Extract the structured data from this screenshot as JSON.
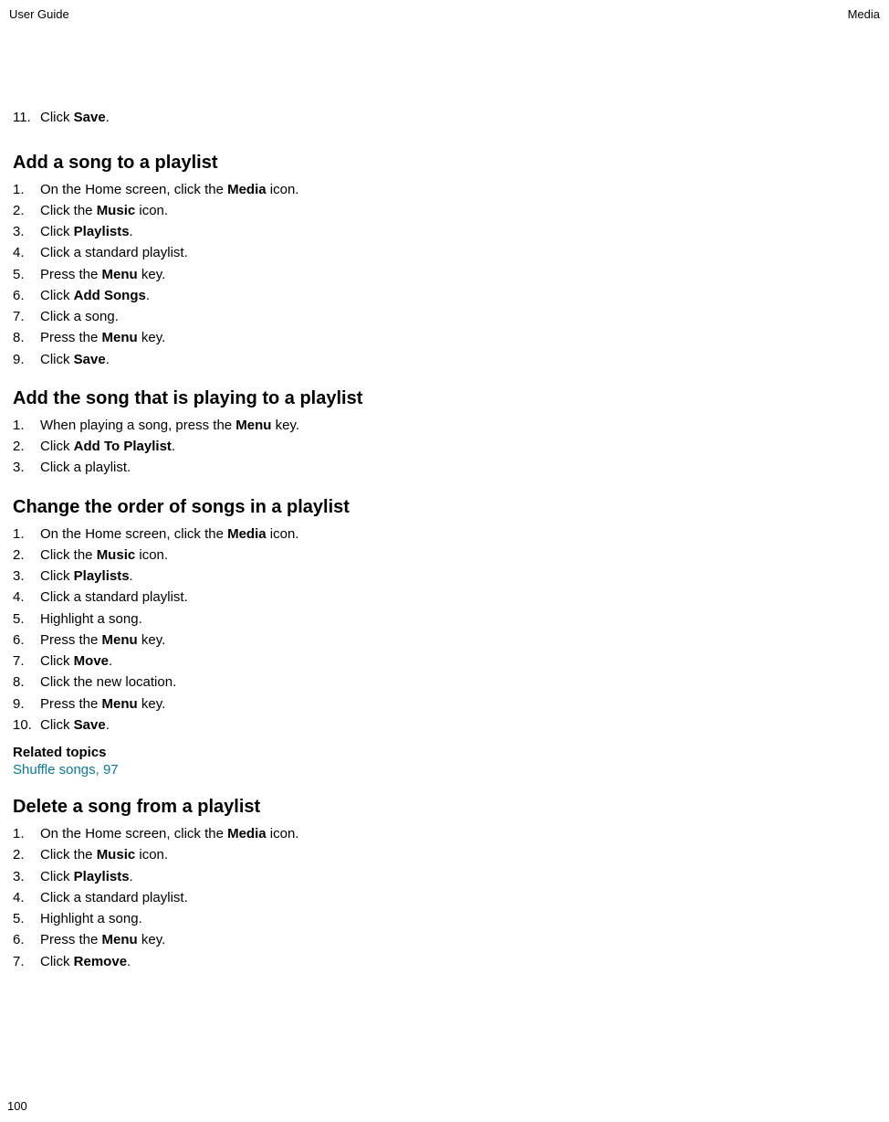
{
  "header": {
    "left": "User Guide",
    "right": "Media"
  },
  "page_number": "100",
  "first_step": {
    "number": "11.",
    "pre": "Click ",
    "bold": "Save",
    "post": "."
  },
  "sections": [
    {
      "title": "Add a song to a playlist",
      "steps": [
        {
          "num": "1.",
          "parts": [
            {
              "t": "On the Home screen, click the "
            },
            {
              "b": "Media"
            },
            {
              "t": " icon."
            }
          ]
        },
        {
          "num": "2.",
          "parts": [
            {
              "t": "Click the "
            },
            {
              "b": "Music"
            },
            {
              "t": " icon."
            }
          ]
        },
        {
          "num": "3.",
          "parts": [
            {
              "t": "Click "
            },
            {
              "b": "Playlists"
            },
            {
              "t": "."
            }
          ]
        },
        {
          "num": "4.",
          "parts": [
            {
              "t": "Click a standard playlist."
            }
          ]
        },
        {
          "num": "5.",
          "parts": [
            {
              "t": "Press the "
            },
            {
              "b": "Menu"
            },
            {
              "t": " key."
            }
          ]
        },
        {
          "num": "6.",
          "parts": [
            {
              "t": "Click "
            },
            {
              "b": "Add Songs"
            },
            {
              "t": "."
            }
          ]
        },
        {
          "num": "7.",
          "parts": [
            {
              "t": "Click a song."
            }
          ]
        },
        {
          "num": "8.",
          "parts": [
            {
              "t": "Press the "
            },
            {
              "b": "Menu"
            },
            {
              "t": " key."
            }
          ]
        },
        {
          "num": "9.",
          "parts": [
            {
              "t": "Click "
            },
            {
              "b": "Save"
            },
            {
              "t": "."
            }
          ]
        }
      ]
    },
    {
      "title": "Add the song that is playing to a playlist",
      "steps": [
        {
          "num": "1.",
          "parts": [
            {
              "t": "When playing a song, press the "
            },
            {
              "b": "Menu"
            },
            {
              "t": " key."
            }
          ]
        },
        {
          "num": "2.",
          "parts": [
            {
              "t": "Click "
            },
            {
              "b": "Add To Playlist"
            },
            {
              "t": "."
            }
          ]
        },
        {
          "num": "3.",
          "parts": [
            {
              "t": "Click a playlist."
            }
          ]
        }
      ]
    },
    {
      "title": "Change the order of songs in a playlist",
      "steps": [
        {
          "num": "1.",
          "parts": [
            {
              "t": "On the Home screen, click the "
            },
            {
              "b": "Media"
            },
            {
              "t": " icon."
            }
          ]
        },
        {
          "num": "2.",
          "parts": [
            {
              "t": "Click the "
            },
            {
              "b": "Music"
            },
            {
              "t": " icon."
            }
          ]
        },
        {
          "num": "3.",
          "parts": [
            {
              "t": "Click "
            },
            {
              "b": "Playlists"
            },
            {
              "t": "."
            }
          ]
        },
        {
          "num": "4.",
          "parts": [
            {
              "t": "Click a standard playlist."
            }
          ]
        },
        {
          "num": "5.",
          "parts": [
            {
              "t": "Highlight a song."
            }
          ]
        },
        {
          "num": "6.",
          "parts": [
            {
              "t": "Press the "
            },
            {
              "b": "Menu"
            },
            {
              "t": " key."
            }
          ]
        },
        {
          "num": "7.",
          "parts": [
            {
              "t": "Click "
            },
            {
              "b": "Move"
            },
            {
              "t": "."
            }
          ]
        },
        {
          "num": "8.",
          "parts": [
            {
              "t": "Click the new location."
            }
          ]
        },
        {
          "num": "9.",
          "parts": [
            {
              "t": "Press the "
            },
            {
              "b": "Menu"
            },
            {
              "t": " key."
            }
          ]
        },
        {
          "num": "10.",
          "parts": [
            {
              "t": "Click "
            },
            {
              "b": "Save"
            },
            {
              "t": "."
            }
          ]
        }
      ],
      "related": {
        "label": "Related topics",
        "link_text": "Shuffle songs, 97"
      }
    },
    {
      "title": "Delete a song from a playlist",
      "steps": [
        {
          "num": "1.",
          "parts": [
            {
              "t": "On the Home screen, click the "
            },
            {
              "b": "Media"
            },
            {
              "t": " icon."
            }
          ]
        },
        {
          "num": "2.",
          "parts": [
            {
              "t": "Click the "
            },
            {
              "b": "Music"
            },
            {
              "t": " icon."
            }
          ]
        },
        {
          "num": "3.",
          "parts": [
            {
              "t": "Click "
            },
            {
              "b": "Playlists"
            },
            {
              "t": "."
            }
          ]
        },
        {
          "num": "4.",
          "parts": [
            {
              "t": "Click a standard playlist."
            }
          ]
        },
        {
          "num": "5.",
          "parts": [
            {
              "t": "Highlight a song."
            }
          ]
        },
        {
          "num": "6.",
          "parts": [
            {
              "t": "Press the "
            },
            {
              "b": "Menu"
            },
            {
              "t": " key."
            }
          ]
        },
        {
          "num": "7.",
          "parts": [
            {
              "t": "Click "
            },
            {
              "b": "Remove"
            },
            {
              "t": "."
            }
          ]
        }
      ]
    }
  ]
}
